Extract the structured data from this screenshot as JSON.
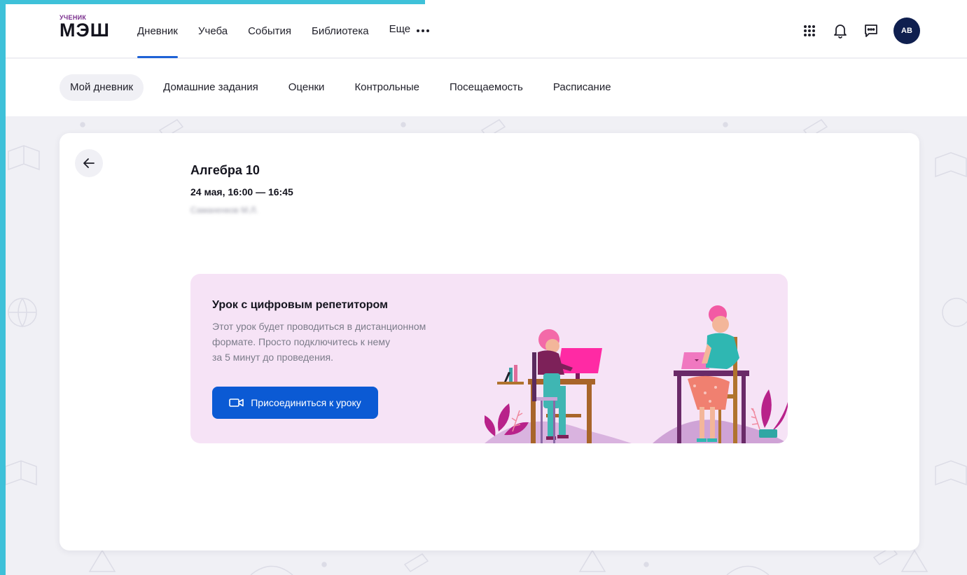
{
  "app": {
    "logo_sub": "УЧЕНИК",
    "logo_main": "МЭШ"
  },
  "main_nav": {
    "items": [
      {
        "label": "Дневник",
        "active": true
      },
      {
        "label": "Учеба",
        "active": false
      },
      {
        "label": "События",
        "active": false
      },
      {
        "label": "Библиотека",
        "active": false
      }
    ],
    "more_label": "Еще"
  },
  "header_icons": {
    "apps": "apps-grid-icon",
    "notifications": "bell-icon",
    "messages": "chat-icon",
    "avatar_initials": "АВ"
  },
  "sub_nav": {
    "items": [
      {
        "label": "Мой дневник",
        "active": true
      },
      {
        "label": "Домашние задания",
        "active": false
      },
      {
        "label": "Оценки",
        "active": false
      },
      {
        "label": "Контрольные",
        "active": false
      },
      {
        "label": "Посещаемость",
        "active": false
      },
      {
        "label": "Расписание",
        "active": false
      }
    ]
  },
  "lesson": {
    "title": "Алгебра 10",
    "time": "24 мая, 16:00 — 16:45",
    "teacher": "Саманенков М.Л."
  },
  "promo": {
    "title": "Урок с цифровым репетитором",
    "text_lines": [
      "Этот урок будет проводиться в дистанционном",
      "формате. Просто подключитесь к нему",
      "за 5 минут до проведения."
    ],
    "button_label": "Присоединиться к уроку"
  },
  "colors": {
    "accent_strip": "#3ec1d9",
    "active_tab": "#1e62d6",
    "button": "#0b5ad4",
    "promo_bg": "#f6e3f6",
    "avatar_bg": "#0f1f4f"
  }
}
